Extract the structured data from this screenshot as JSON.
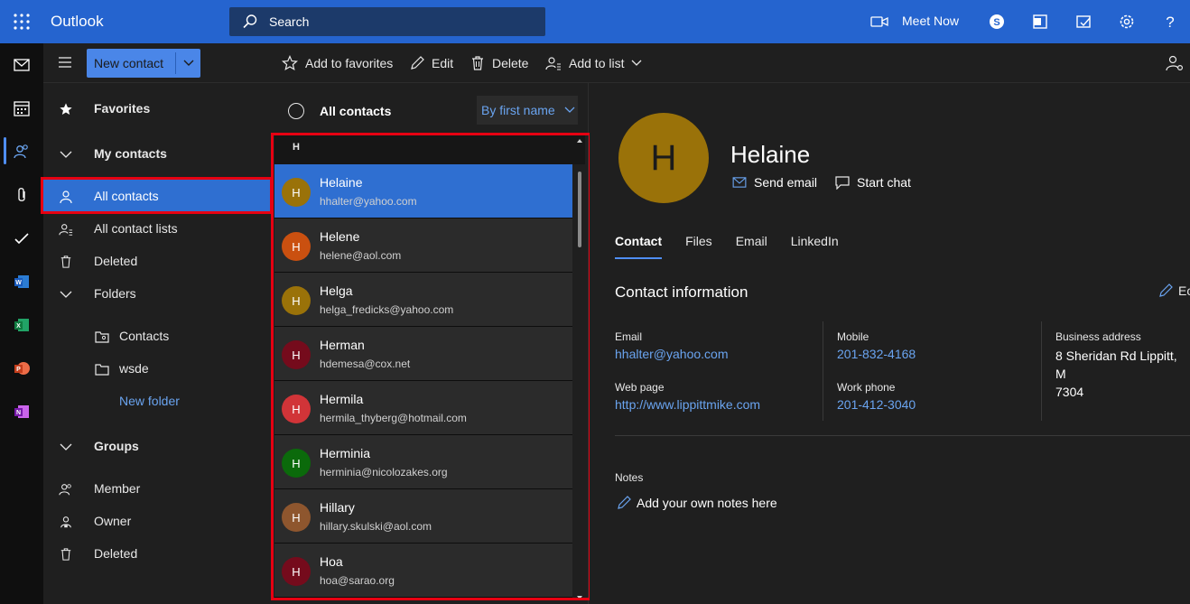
{
  "topbar": {
    "app_name": "Outlook",
    "search_placeholder": "Search",
    "meet_now": "Meet Now"
  },
  "toolbar": {
    "new_contact": "New contact",
    "add_to_favorites": "Add to favorites",
    "edit": "Edit",
    "delete": "Delete",
    "add_to_list": "Add to list"
  },
  "folders": {
    "favorites": "Favorites",
    "my_contacts": "My contacts",
    "all_contacts": "All contacts",
    "all_contact_lists": "All contact lists",
    "deleted": "Deleted",
    "folders": "Folders",
    "contacts": "Contacts",
    "wsde": "wsde",
    "new_folder": "New folder",
    "groups": "Groups",
    "member": "Member",
    "owner": "Owner",
    "groups_deleted": "Deleted"
  },
  "list": {
    "title": "All contacts",
    "sort": "By first name",
    "letter": "H",
    "contacts": [
      {
        "initial": "H",
        "name": "Helaine",
        "email": "hhalter@yahoo.com",
        "color": "#9a7209"
      },
      {
        "initial": "H",
        "name": "Helene",
        "email": "helene@aol.com",
        "color": "#ca5010"
      },
      {
        "initial": "H",
        "name": "Helga",
        "email": "helga_fredicks@yahoo.com",
        "color": "#9a7209"
      },
      {
        "initial": "H",
        "name": "Herman",
        "email": "hdemesa@cox.net",
        "color": "#750b1c"
      },
      {
        "initial": "H",
        "name": "Hermila",
        "email": "hermila_thyberg@hotmail.com",
        "color": "#d13438"
      },
      {
        "initial": "H",
        "name": "Herminia",
        "email": "herminia@nicolozakes.org",
        "color": "#0b6a0b"
      },
      {
        "initial": "H",
        "name": "Hillary",
        "email": "hillary.skulski@aol.com",
        "color": "#8e562e"
      },
      {
        "initial": "H",
        "name": "Hoa",
        "email": "hoa@sarao.org",
        "color": "#750b1c"
      }
    ]
  },
  "details": {
    "initial": "H",
    "name": "Helaine",
    "send_email": "Send email",
    "start_chat": "Start chat",
    "tabs": [
      "Contact",
      "Files",
      "Email",
      "LinkedIn"
    ],
    "section_title": "Contact information",
    "edit": "Ec",
    "email_label": "Email",
    "email_value": "hhalter@yahoo.com",
    "webpage_label": "Web page",
    "webpage_value": "http://www.lippittmike.com",
    "mobile_label": "Mobile",
    "mobile_value": "201-832-4168",
    "workphone_label": "Work phone",
    "workphone_value": "201-412-3040",
    "business_label": "Business address",
    "business_line1": "8 Sheridan Rd Lippitt, M",
    "business_line2": "7304",
    "notes_label": "Notes",
    "notes_add": "Add your own notes here"
  }
}
